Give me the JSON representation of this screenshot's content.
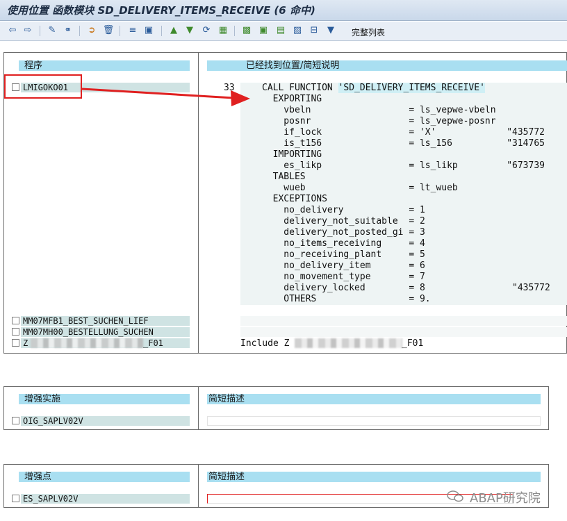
{
  "window": {
    "title": "使用位置 函数模块 SD_DELIVERY_ITEMS_RECEIVE (6 命中)"
  },
  "toolbar": {
    "icons": [
      "back-icon",
      "forward-icon",
      "edit-icon",
      "glasses-icon",
      "transfer-icon",
      "delete-icon",
      "sort-icon",
      "window-icon",
      "filter-up-icon",
      "filter-down-icon",
      "refresh-icon",
      "export-icon",
      "grid-icon",
      "select-all-icon",
      "layout-icon",
      "detail-icon",
      "remove-icon",
      "filter-icon"
    ],
    "full_list_label": "完整列表"
  },
  "where_used": {
    "col_program": "程序",
    "col_found": "已经找到位置/简短说明",
    "programs": [
      {
        "name": "LMIGOKO01"
      },
      {
        "name": "MM07MFB1_BEST_SUCHEN_LIEF"
      },
      {
        "name": "MM07MH00_BESTELLUNG_SUCHEN"
      },
      {
        "name_prefix": "Z",
        "name_suffix": "_F01"
      }
    ],
    "code": {
      "line_no": "33",
      "lines": [
        "CALL FUNCTION 'SD_DELIVERY_ITEMS_RECEIVE'",
        "  EXPORTING",
        "    vbeln                  = ls_vepwe-vbeln",
        "    posnr                  = ls_vepwe-posnr",
        "    if_lock                = 'X'             \"435772",
        "    is_t156                = ls_156          \"314765",
        "  IMPORTING",
        "    es_likp                = ls_likp         \"673739",
        "  TABLES",
        "    wueb                   = lt_wueb",
        "  EXCEPTIONS",
        "    no_delivery            = 1",
        "    delivery_not_suitable  = 2",
        "    delivery_not_posted_gi = 3",
        "    no_items_receiving     = 4",
        "    no_receiving_plant     = 5",
        "    no_delivery_item       = 6",
        "    no_movement_type       = 7",
        "    delivery_locked        = 8                \"435772",
        "    OTHERS                 = 9."
      ],
      "include_prefix": "Include Z",
      "include_suffix": "_F01"
    }
  },
  "enhancement_impl": {
    "col_name": "增强实施",
    "col_desc": "简短描述",
    "rows": [
      {
        "name": "OIG_SAPLV02V",
        "desc": ""
      }
    ]
  },
  "enhancement_point": {
    "col_name": "增强点",
    "col_desc": "简短描述",
    "rows": [
      {
        "name": "ES_SAPLV02V",
        "desc": ""
      }
    ]
  },
  "watermark": {
    "text": "ABAP研究院"
  },
  "colors": {
    "header": "#a9dff1",
    "row": "#cfe3e3",
    "annotation": "#e02020"
  }
}
